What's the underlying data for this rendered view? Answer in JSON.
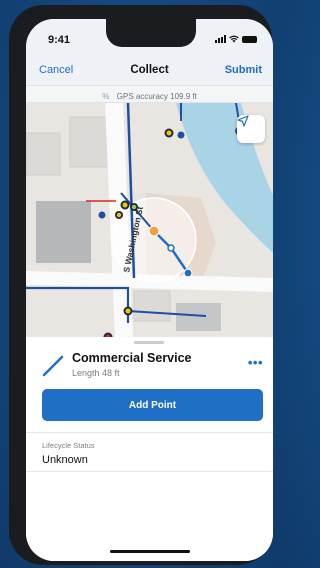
{
  "status": {
    "time": "9:41"
  },
  "nav": {
    "cancel": "Cancel",
    "title": "Collect",
    "submit": "Submit"
  },
  "gps": {
    "icon": "location-signal-icon",
    "text": "GPS accuracy 109.9 ft"
  },
  "map": {
    "street_label": "S Washington St",
    "locate_icon": "navigation-arrow-icon"
  },
  "feature": {
    "title": "Commercial Service",
    "subtitle": "Length 48 ft",
    "line_color": "#1f6fc6"
  },
  "actions": {
    "add_point": "Add Point"
  },
  "fields": [
    {
      "label": "Lifecycle Status",
      "value": "Unknown"
    }
  ],
  "colors": {
    "accent": "#1f6fc6",
    "water": "#a8d4e6",
    "pipe": "#1e4fa3"
  }
}
